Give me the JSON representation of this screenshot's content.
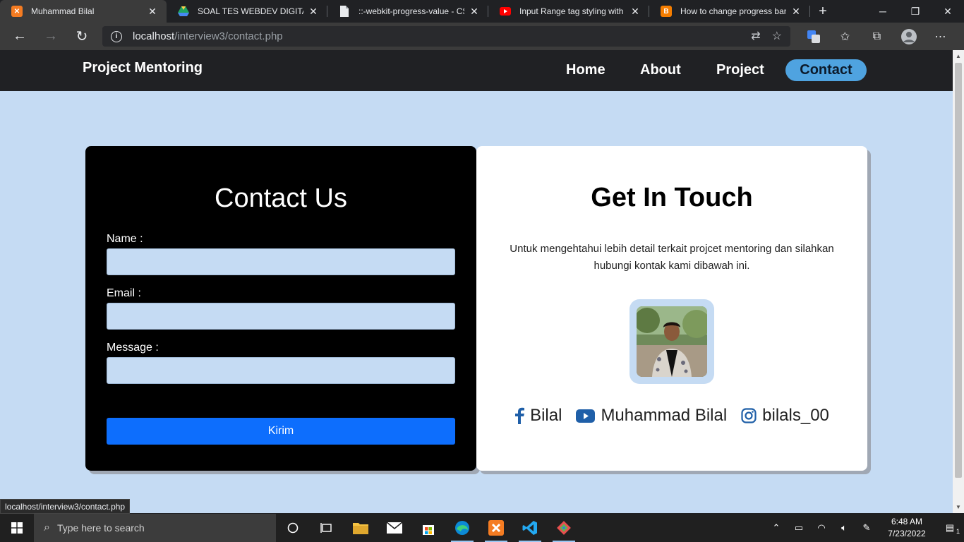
{
  "browser": {
    "tabs": [
      {
        "title": "Muhammad Bilal",
        "favicon": "xampp-icon",
        "color": "#f57c22",
        "active": true
      },
      {
        "title": "SOAL TES WEBDEV DIGITALIZ",
        "favicon": "google-drive-icon",
        "color": "#1fa463",
        "active": false
      },
      {
        "title": "::-webkit-progress-value - CSS",
        "favicon": "document-icon",
        "color": "#e8eaed",
        "active": false
      },
      {
        "title": "Input Range tag styling with C",
        "favicon": "youtube-icon",
        "color": "#ff0000",
        "active": false
      },
      {
        "title": "How to change progress bar p",
        "favicon": "blogger-icon",
        "color": "#f57d00",
        "active": false
      }
    ],
    "url_host": "localhost",
    "url_path": "/interview3/contact.php",
    "status_url": "localhost/interview3/contact.php"
  },
  "site": {
    "brand": "Project Mentoring",
    "nav": [
      {
        "label": "Home"
      },
      {
        "label": "About"
      },
      {
        "label": "Project"
      },
      {
        "label": "Contact",
        "active": true
      }
    ]
  },
  "contact_form": {
    "title": "Contact Us",
    "name_label": "Name :",
    "email_label": "Email :",
    "message_label": "Message :",
    "name_value": "",
    "email_value": "",
    "message_value": "",
    "submit_label": "Kirim"
  },
  "get_in_touch": {
    "title": "Get In Touch",
    "description": "Untuk mengehtahui lebih detail terkait projcet mentoring dan silahkan hubungi kontak kami dibawah ini.",
    "socials": [
      {
        "icon": "facebook-icon",
        "label": "Bilal"
      },
      {
        "icon": "youtube-icon",
        "label": "Muhammad Bilal"
      },
      {
        "icon": "instagram-icon",
        "label": "bilals_00"
      }
    ]
  },
  "taskbar": {
    "search_placeholder": "Type here to search",
    "time": "6:48 AM",
    "date": "7/23/2022",
    "notification_count": "1"
  },
  "colors": {
    "page_bg": "#c5dbf3",
    "navbar_bg": "#202124",
    "nav_active": "#4fa3e0",
    "button_primary": "#0d6efd",
    "social_icon": "#1f5fa8"
  }
}
